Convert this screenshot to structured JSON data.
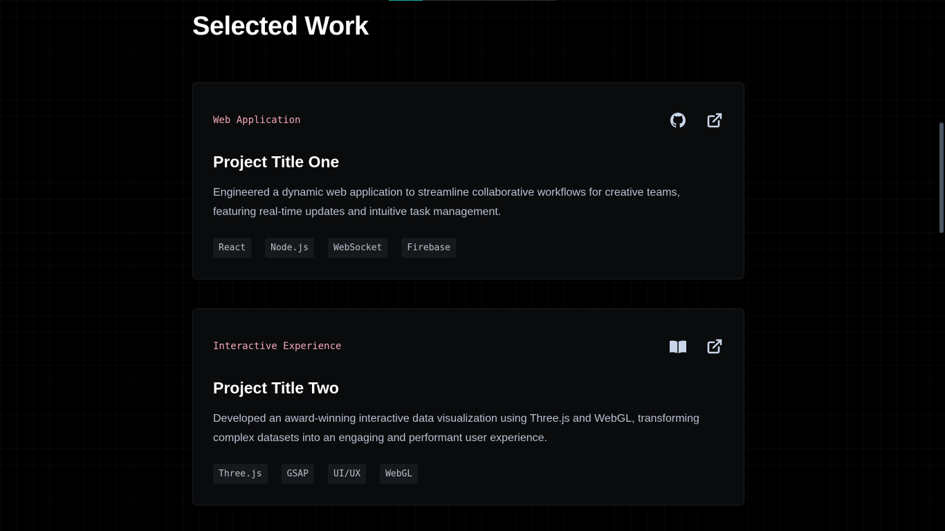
{
  "section": {
    "title": "Selected Work"
  },
  "projects": [
    {
      "category": "Web Application",
      "title": "Project Title One",
      "description": "Engineered a dynamic web application to streamline collaborative workflows for creative teams, featuring real-time updates and intuitive task management.",
      "tags": [
        "React",
        "Node.js",
        "WebSocket",
        "Firebase"
      ],
      "icons": [
        "github-icon",
        "external-link-icon"
      ]
    },
    {
      "category": "Interactive Experience",
      "title": "Project Title Two",
      "description": "Developed an award-winning interactive data visualization using Three.js and WebGL, transforming complex datasets into an engaging and performant user experience.",
      "tags": [
        "Three.js",
        "GSAP",
        "UI/UX",
        "WebGL"
      ],
      "icons": [
        "book-icon",
        "external-link-icon"
      ]
    }
  ],
  "colors": {
    "background": "#000000",
    "card_background": "#0a0b0c",
    "accent": "#14b8a6",
    "category_text": "#f2a7b6",
    "heading": "#ffffff",
    "body_text": "#b9c3d3",
    "tag_background": "#16191c"
  }
}
